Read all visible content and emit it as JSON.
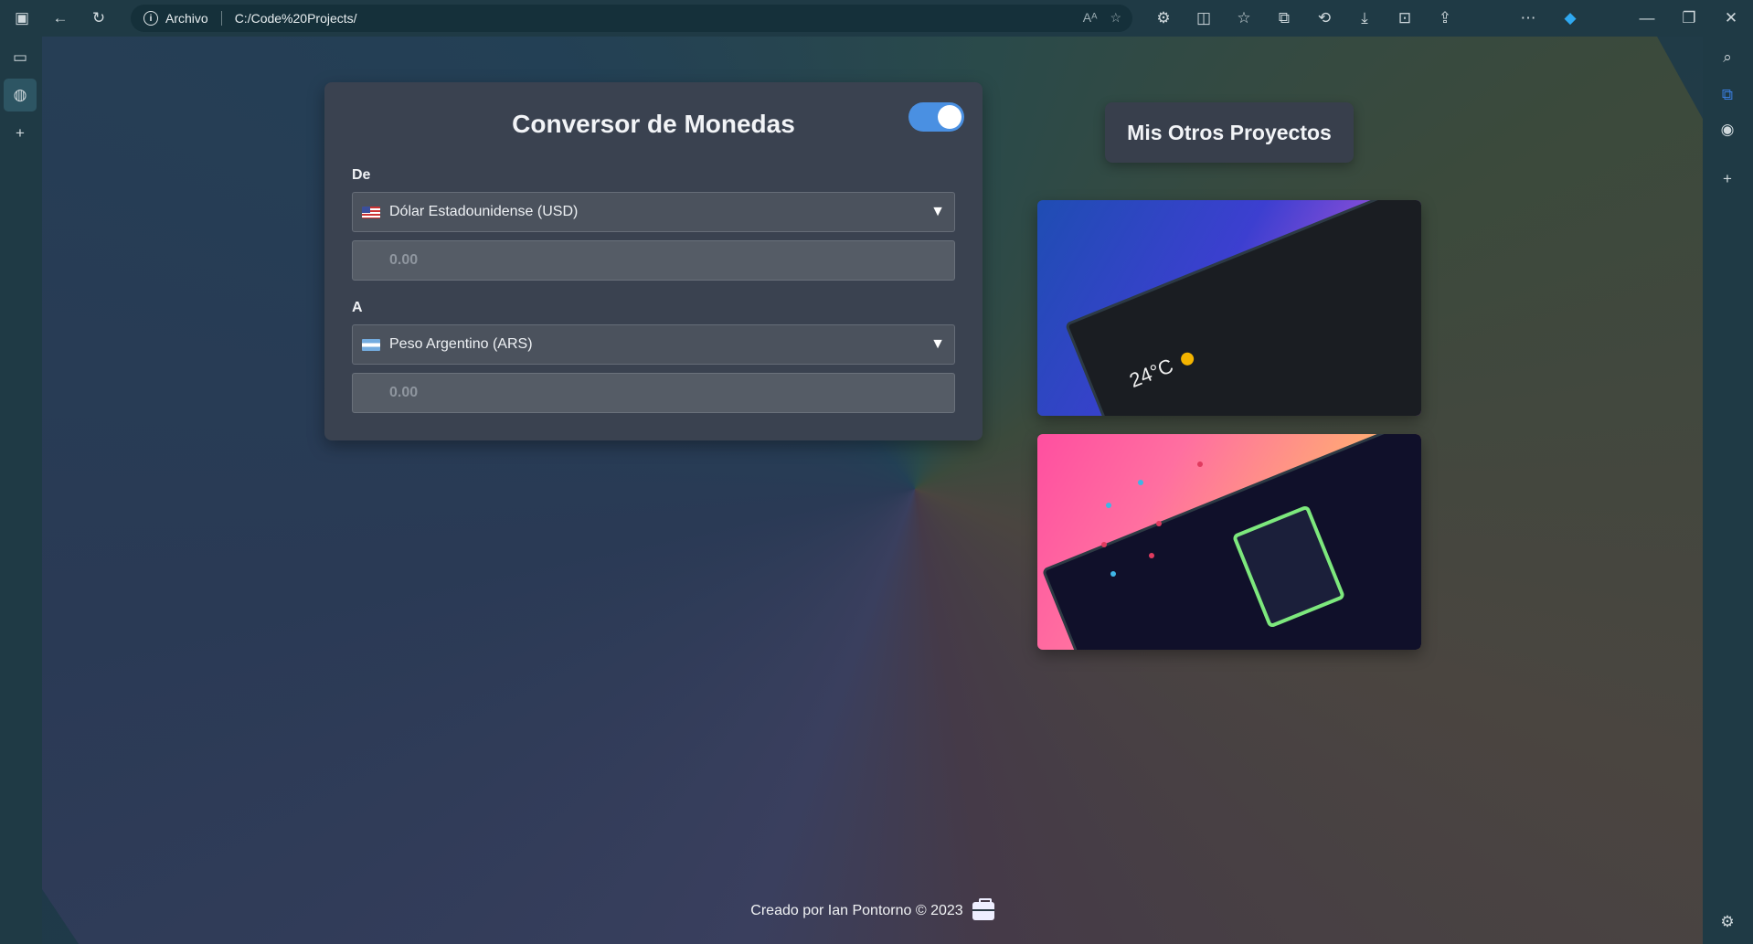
{
  "browser": {
    "address_label": "Archivo",
    "url": "C:/Code%20Projects/"
  },
  "converter": {
    "title": "Conversor de Monedas",
    "theme_toggle_on": true,
    "from_label": "De",
    "from_currency": "Dólar Estadounidense (USD)",
    "from_amount_placeholder": "0.00",
    "to_label": "A",
    "to_currency": "Peso Argentino (ARS)",
    "to_amount_placeholder": "0.00"
  },
  "projects": {
    "title": "Mis Otros Proyectos",
    "weather_temp": "24°C"
  },
  "footer": {
    "text": "Creado por Ian Pontorno © 2023"
  },
  "colors": {
    "accent": "#4a90e2",
    "card": "#3a4250"
  }
}
